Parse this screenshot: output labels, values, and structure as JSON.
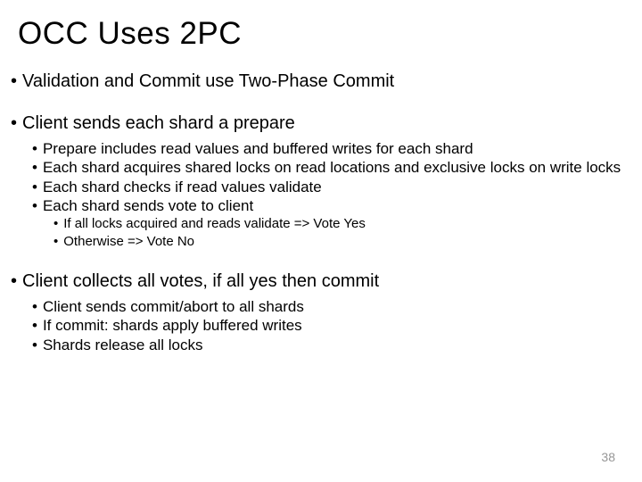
{
  "title": "OCC Uses 2PC",
  "points": {
    "p1": "Validation and Commit use Two-Phase Commit",
    "p2": "Client sends each shard a prepare",
    "p2_1": "Prepare includes read values and buffered writes for each shard",
    "p2_2": "Each shard acquires shared locks on read locations and exclusive locks on write locks",
    "p2_3": "Each shard checks if read values validate",
    "p2_4": "Each shard sends vote to client",
    "p2_4_1": "If all locks acquired and reads validate => Vote Yes",
    "p2_4_2": "Otherwise => Vote No",
    "p3": "Client collects all votes, if all yes then commit",
    "p3_1": "Client sends commit/abort to all shards",
    "p3_2": "If commit: shards apply buffered writes",
    "p3_3": "Shards release all locks"
  },
  "slide_number": "38"
}
